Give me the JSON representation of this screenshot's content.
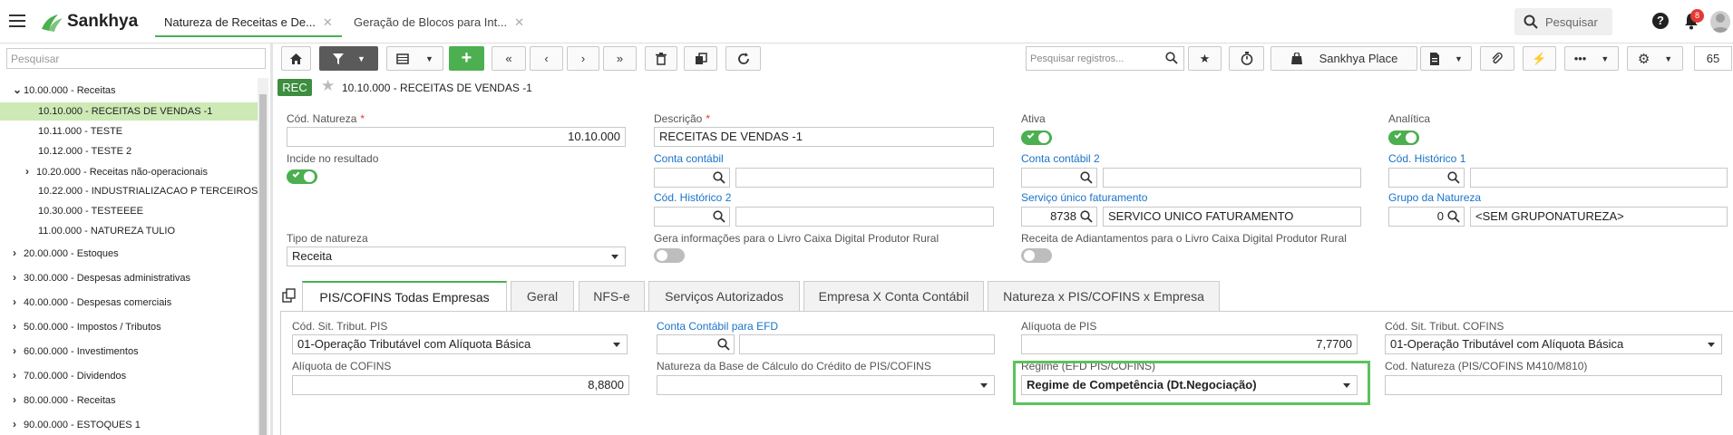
{
  "app": {
    "name": "Sankhya"
  },
  "tabs": [
    {
      "label": "Natureza de Receitas e De..."
    },
    {
      "label": "Geração de Blocos para Int..."
    }
  ],
  "top_search": {
    "placeholder": "Pesquisar"
  },
  "notifications": {
    "count": "8"
  },
  "sidebar": {
    "search_placeholder": "Pesquisar",
    "items": [
      {
        "label": "10.00.000 - Receitas",
        "level": 0,
        "expanded": true
      },
      {
        "label": "10.10.000 - RECEITAS DE VENDAS -1",
        "level": 2,
        "selected": true
      },
      {
        "label": "10.11.000 - TESTE",
        "level": 2
      },
      {
        "label": "10.12.000 - TESTE 2",
        "level": 2
      },
      {
        "label": "10.20.000 - Receitas não-operacionais",
        "level": 1
      },
      {
        "label": "10.22.000 - INDUSTRIALIZACAO P TERCEIROS",
        "level": 2
      },
      {
        "label": "10.30.000 - TESTEEEE",
        "level": 2
      },
      {
        "label": "11.00.000 - NATUREZA TULIO",
        "level": 2
      },
      {
        "label": "20.00.000 - Estoques",
        "level": 0
      },
      {
        "label": "30.00.000 - Despesas administrativas",
        "level": 0
      },
      {
        "label": "40.00.000 - Despesas comerciais",
        "level": 0
      },
      {
        "label": "50.00.000 - Impostos / Tributos",
        "level": 0
      },
      {
        "label": "60.00.000 - Investimentos",
        "level": 0
      },
      {
        "label": "70.00.000 - Dividendos",
        "level": 0
      },
      {
        "label": "80.00.000 - Receitas",
        "level": 0
      },
      {
        "label": "90.00.000 - ESTOQUES 1",
        "level": 0
      }
    ]
  },
  "toolbar": {
    "search_placeholder": "Pesquisar registros...",
    "place_label": "Sankhya Place",
    "page_number": "65"
  },
  "record": {
    "badge": "REC",
    "title": "10.10.000 - RECEITAS DE VENDAS -1"
  },
  "form": {
    "cod_natureza": {
      "label": "Cód. Natureza",
      "value": "10.10.000"
    },
    "descricao": {
      "label": "Descrição",
      "value": "RECEITAS DE VENDAS -1"
    },
    "ativa": {
      "label": "Ativa"
    },
    "analitica": {
      "label": "Analítica"
    },
    "incide": {
      "label": "Incide no resultado"
    },
    "conta_contabil": {
      "label": "Conta contábil"
    },
    "conta_contabil2": {
      "label": "Conta contábil 2"
    },
    "cod_hist1": {
      "label": "Cód. Histórico 1"
    },
    "cod_hist2": {
      "label": "Cód. Histórico 2"
    },
    "servico": {
      "label": "Serviço único faturamento",
      "code": "8738",
      "desc": "SERVICO UNICO FATURAMENTO"
    },
    "grupo": {
      "label": "Grupo da Natureza",
      "code": "0",
      "desc": "<SEM GRUPONATUREZA>"
    },
    "tipo": {
      "label": "Tipo de natureza",
      "value": "Receita"
    },
    "gera_info": {
      "label": "Gera informações para o Livro Caixa Digital Produtor Rural"
    },
    "receita_adiant": {
      "label": "Receita de Adiantamentos para o Livro Caixa Digital Produtor Rural"
    }
  },
  "form_tabs": [
    {
      "label": "PIS/COFINS Todas Empresas"
    },
    {
      "label": "Geral"
    },
    {
      "label": "NFS-e"
    },
    {
      "label": "Serviços Autorizados"
    },
    {
      "label": "Empresa X Conta Contábil"
    },
    {
      "label": "Natureza x PIS/COFINS x Empresa"
    }
  ],
  "pis": {
    "cst_pis": {
      "label": "Cód. Sit. Tribut. PIS",
      "value": "01-Operação Tributável com Alíquota Básica"
    },
    "conta_efd": {
      "label": "Conta Contábil para EFD"
    },
    "aliq_pis": {
      "label": "Alíquota de PIS",
      "value": "7,7700"
    },
    "cst_cofins": {
      "label": "Cód. Sit. Tribut. COFINS",
      "value": "01-Operação Tributável com Alíquota Básica"
    },
    "aliq_cofins": {
      "label": "Alíquota de COFINS",
      "value": "8,8800"
    },
    "natureza_base": {
      "label": "Natureza da Base de Cálculo do Crédito de PIS/COFINS"
    },
    "regime": {
      "label": "Regime (EFD PIS/COFINS)",
      "value": "Regime de Competência (Dt.Negociação)"
    },
    "cod_nat": {
      "label": "Cod. Natureza (PIS/COFINS M410/M810)"
    }
  },
  "colors": {
    "accent": "#4caf50",
    "link": "#1a73c9",
    "highlight": "#5cc25c"
  }
}
